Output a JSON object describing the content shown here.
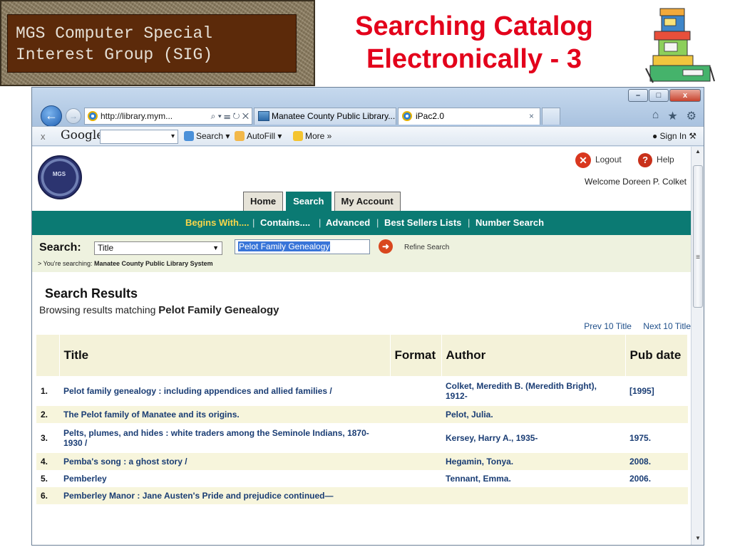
{
  "slide": {
    "banner_text": "MGS Computer Special\nInterest Group (SIG)",
    "title": "Searching Catalog\nElectronically - 3"
  },
  "browser": {
    "address": "http://library.mym...",
    "address_tools": "⌕ ▾ ☰ ↻ ✕",
    "tabs": [
      {
        "label": "Manatee County Public Library...",
        "icon": "library-tab-icon"
      },
      {
        "label": "iPac2.0",
        "icon": "ie-icon",
        "close": "×"
      }
    ],
    "window_buttons": [
      "–",
      "□",
      "x"
    ],
    "icons": [
      "home-icon",
      "star-icon",
      "gear-icon"
    ]
  },
  "toolbar": {
    "close": "x",
    "google_logo": "Google",
    "search_dropdown": "▾",
    "search": "Search ▾",
    "autofill": "AutoFill ▾",
    "more": "More »",
    "sign_in": "Sign In"
  },
  "page": {
    "logo_text": "MGS",
    "logout": "Logout",
    "help": "Help",
    "welcome": "Welcome Doreen P. Colket",
    "tabs": [
      "Home",
      "Search",
      "My Account"
    ],
    "active_tab": "Search",
    "subnav": [
      "Begins With....",
      "Contains....",
      "Advanced",
      "Best Sellers Lists",
      "Number Search"
    ],
    "search_label": "Search:",
    "search_field": "Title",
    "query": "Pelot Family Genealogy",
    "refine": "Refine Search",
    "searching_prefix": "> You're searching:",
    "searching_target": "Manatee County Public Library System",
    "results_heading": "Search Results",
    "browsing_prefix": "Browsing results matching",
    "browsing_query": "Pelot Family Genealogy",
    "prev": "Prev 10 Title",
    "next": "Next 10 Title"
  },
  "results": {
    "columns": [
      "",
      "Title",
      "Format",
      "Author",
      "Pub date"
    ],
    "rows": [
      {
        "num": "1.",
        "title": "Pelot family genealogy : including appendices and allied families /",
        "format": "",
        "author": "Colket, Meredith B. (Meredith Bright), 1912-",
        "date": "[1995]"
      },
      {
        "num": "2.",
        "title": "The Pelot family of Manatee and its origins.",
        "format": "",
        "author": "Pelot, Julia.",
        "date": ""
      },
      {
        "num": "3.",
        "title": "Pelts, plumes, and hides : white traders among the Seminole Indians, 1870-1930 /",
        "format": "",
        "author": "Kersey, Harry A., 1935-",
        "date": "1975."
      },
      {
        "num": "4.",
        "title": "Pemba's song : a ghost story /",
        "format": "",
        "author": "Hegamin, Tonya.",
        "date": "2008."
      },
      {
        "num": "5.",
        "title": "Pemberley",
        "format": "",
        "author": "Tennant, Emma.",
        "date": "2006."
      },
      {
        "num": "6.",
        "title": "Pemberley Manor : Jane Austen's Pride and prejudice continued—",
        "format": "",
        "author": "",
        "date": ""
      }
    ]
  },
  "colors": {
    "title_red": "#e3001b",
    "teal": "#0b7a73",
    "link_blue": "#1a3d74",
    "subnav_highlight": "#f7d54a"
  }
}
